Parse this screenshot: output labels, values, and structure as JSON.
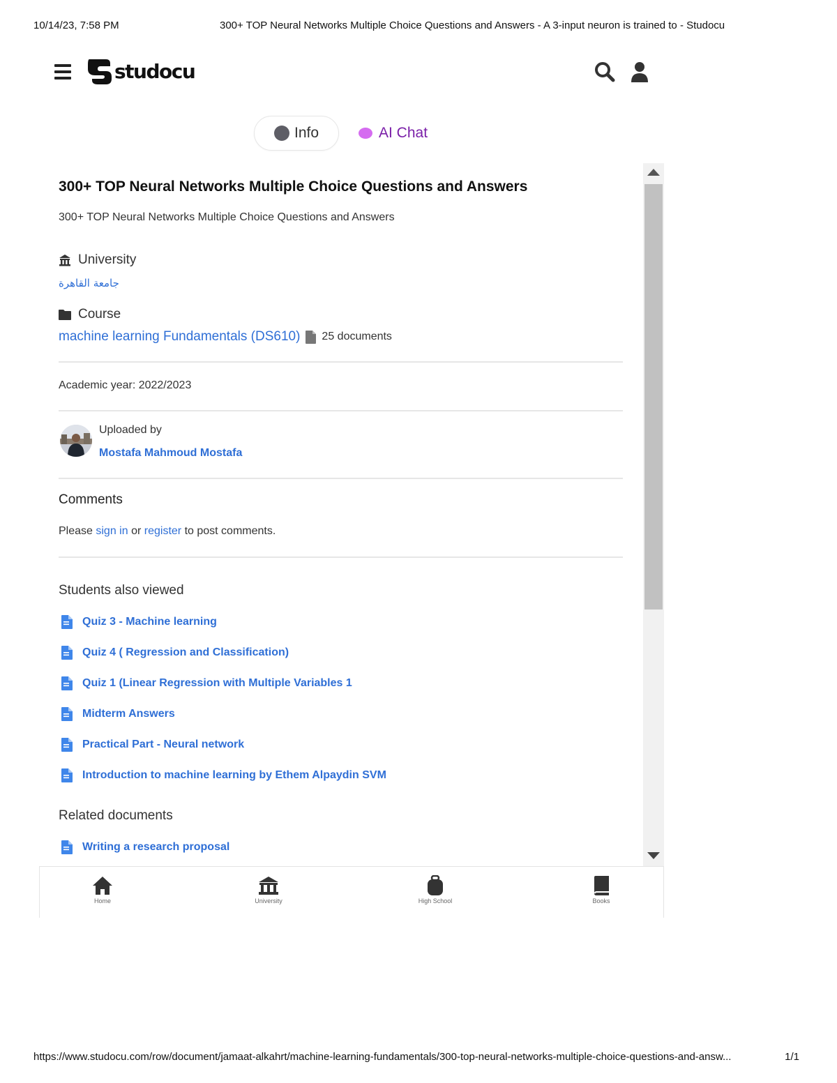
{
  "print": {
    "date": "10/14/23, 7:58 PM",
    "title": "300+ TOP Neural Networks Multiple Choice Questions and Answers - A 3-input neuron is trained to - Studocu",
    "url": "https://www.studocu.com/row/document/jamaat-alkahrt/machine-learning-fundamentals/300-top-neural-networks-multiple-choice-questions-and-answ...",
    "page": "1/1"
  },
  "header": {
    "logo_text": "studocu"
  },
  "tabs": {
    "info": "Info",
    "ai_chat": "AI Chat"
  },
  "document": {
    "title": "300+ TOP Neural Networks Multiple Choice Questions and Answers",
    "subtitle": "300+ TOP Neural Networks Multiple Choice Questions and Answers",
    "university_label": "University",
    "university": "جامعة القاهرة",
    "course_label": "Course",
    "course": "machine learning Fundamentals (DS610)",
    "course_docs": "25 documents",
    "academic_year": "Academic year: 2022/2023",
    "uploaded_by_label": "Uploaded by",
    "uploader": "Mostafa Mahmoud Mostafa"
  },
  "comments": {
    "title": "Comments",
    "prefix": "Please",
    "sign_in": "sign in",
    "or": "or",
    "register": "register",
    "suffix": "to post comments."
  },
  "students_also_viewed": {
    "title": "Students also viewed",
    "items": [
      "Quiz 3 - Machine learning",
      "Quiz 4 ( Regression and Classification)",
      "Quiz 1 (Linear Regression with Multiple Variables 1",
      "Midterm Answers",
      "Practical Part - Neural network",
      "Introduction to machine learning by Ethem Alpaydin SVM"
    ]
  },
  "related_documents": {
    "title": "Related documents",
    "items": [
      "Writing a research proposal"
    ]
  },
  "bottom_nav": {
    "home": "Home",
    "university": "University",
    "high_school": "High School",
    "books": "Books"
  },
  "colors": {
    "link": "#2f6fd6",
    "ai_chat": "#7a1fa8",
    "scroll_thumb": "#c1c1c1"
  }
}
